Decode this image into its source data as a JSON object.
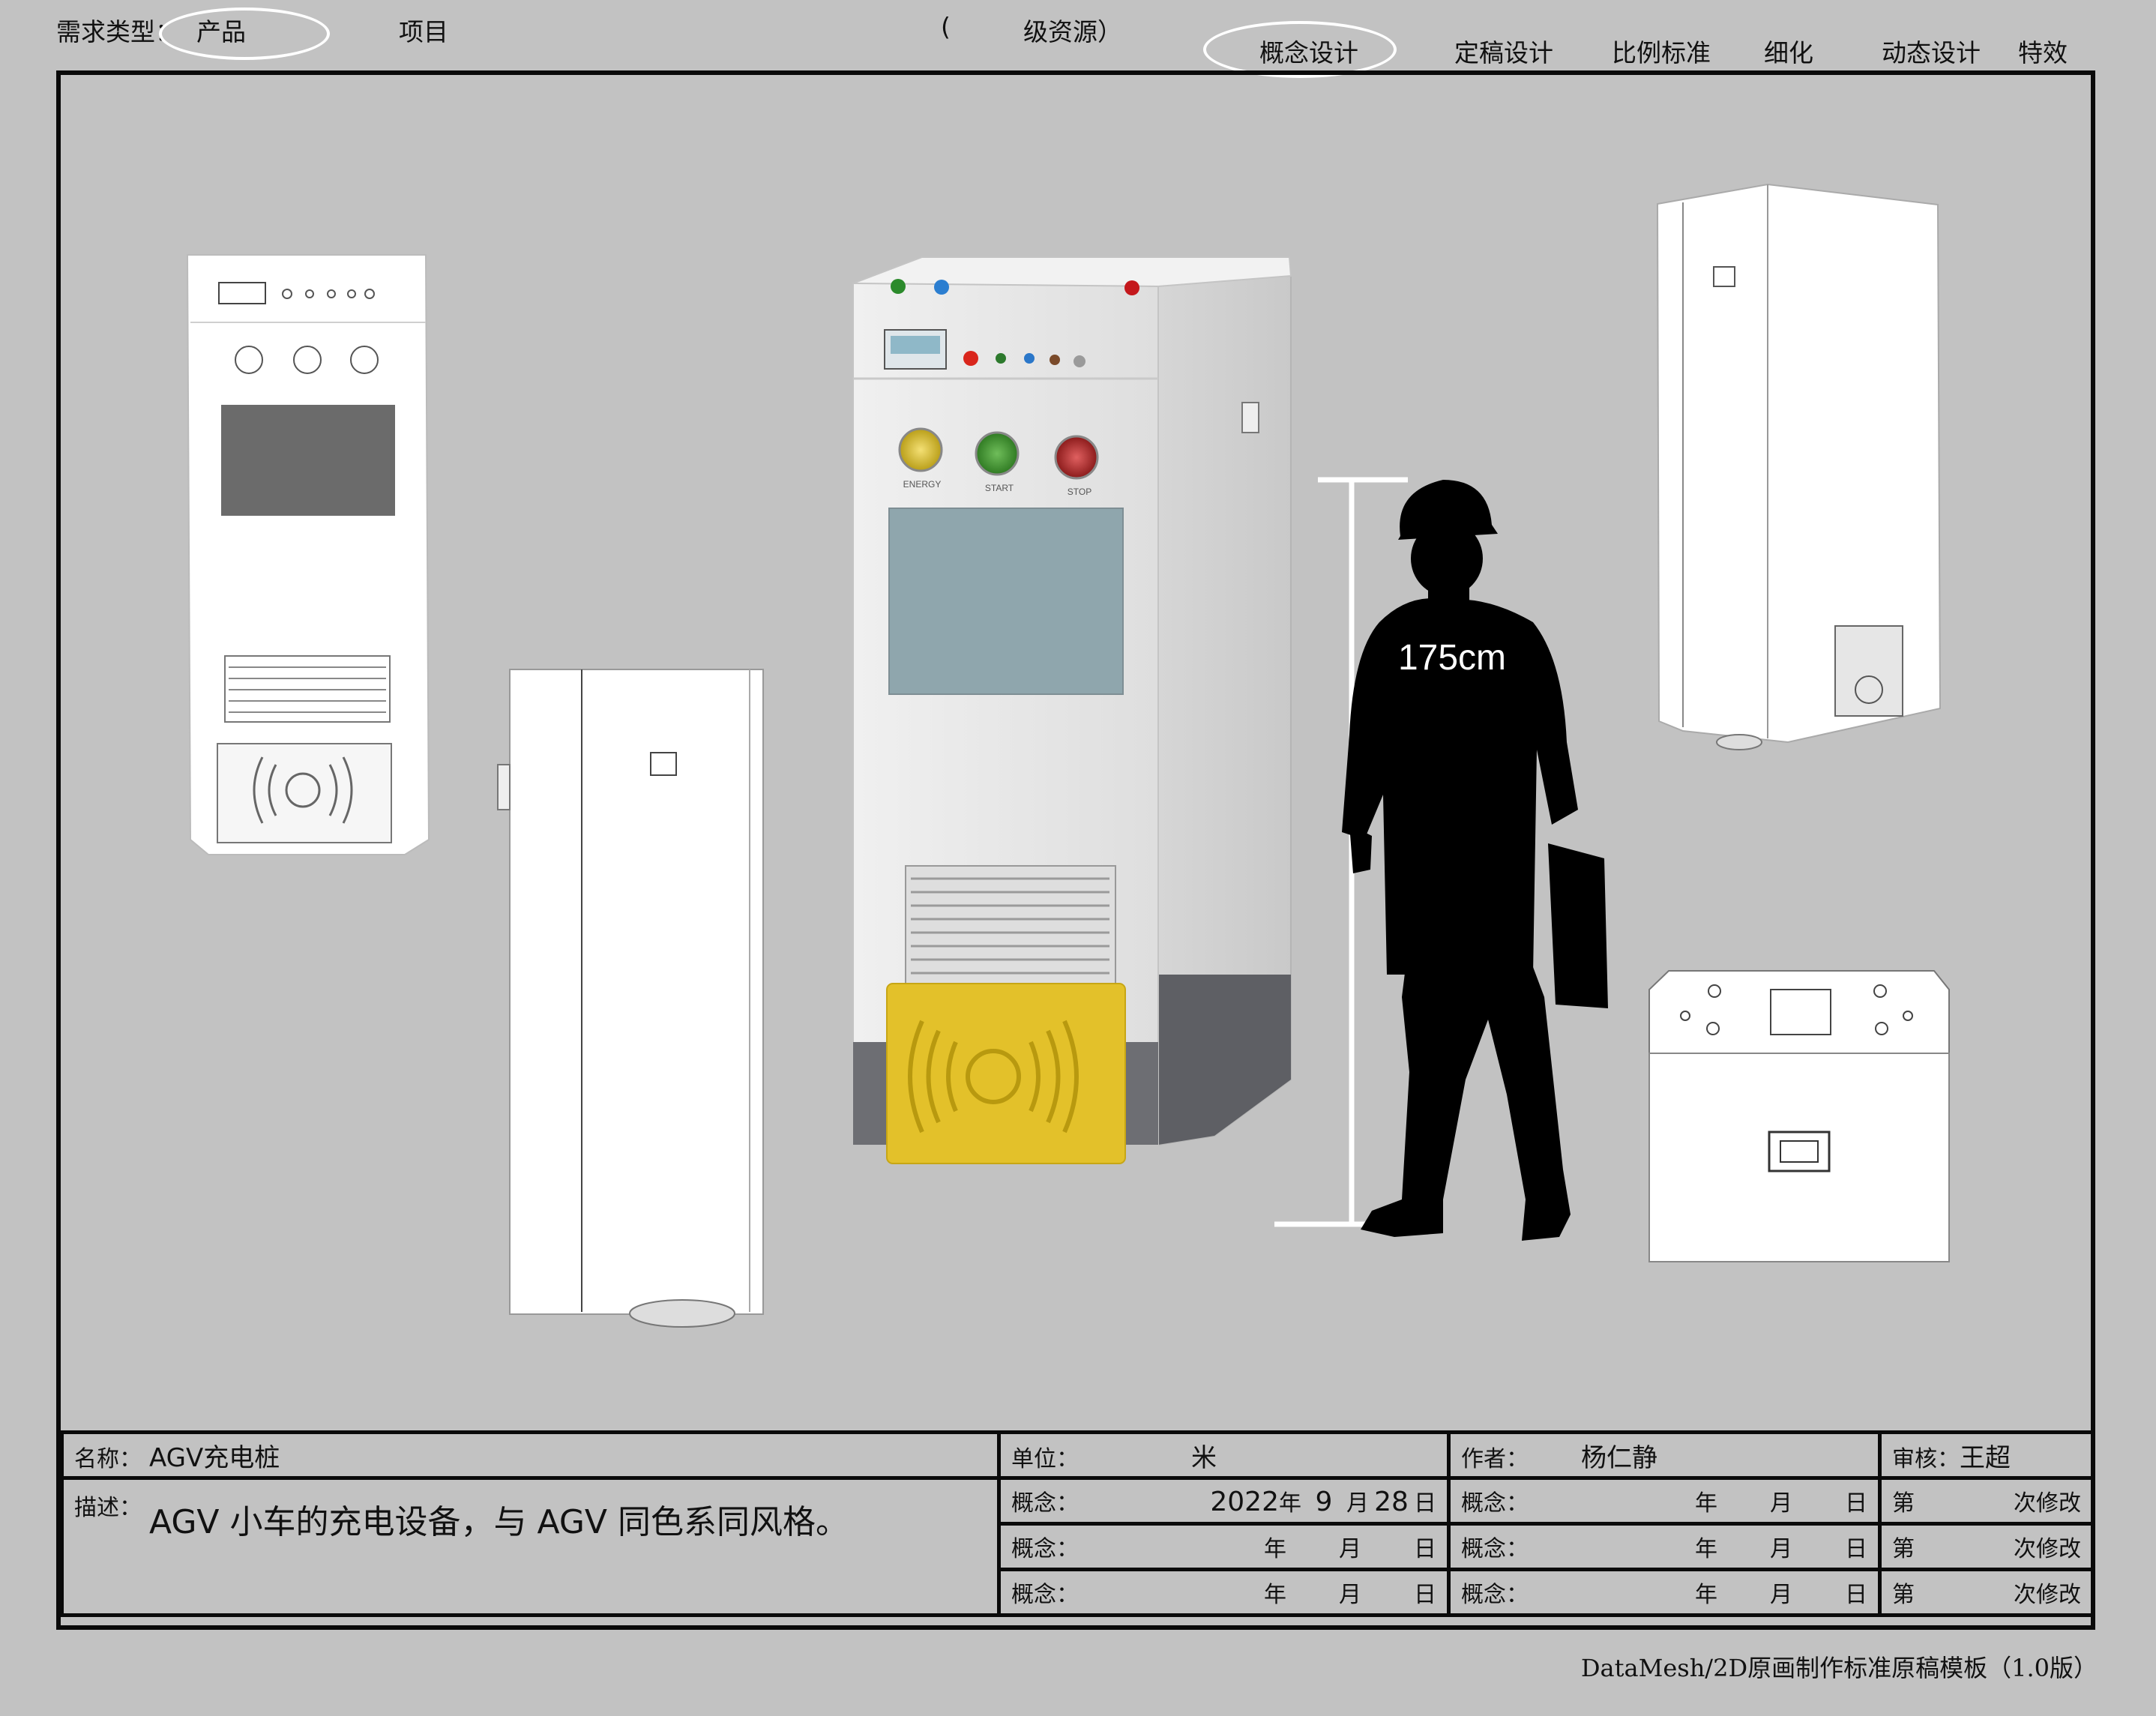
{
  "header": {
    "req_type_label": "需求类型：",
    "req_type_product": "产品",
    "req_type_project": "项目",
    "resource_open": "(",
    "resource_label": "级资源）",
    "stages": [
      "概念设计",
      "定稿设计",
      "比例标准",
      "细化",
      "动态设计",
      "特效"
    ],
    "selected_stage": "概念设计"
  },
  "illustration": {
    "button_labels": [
      "ENERGY",
      "START",
      "STOP"
    ],
    "height_marker": "175cm",
    "colors": {
      "yellow_panel": "#e3c12a",
      "screen": "#8fa6ad",
      "body": "#e6e6e6",
      "base": "#6d6e73",
      "silhouette": "#000000"
    }
  },
  "table": {
    "name_label": "名称：",
    "name_value": "AGV充电桩",
    "desc_label": "描述：",
    "desc_value": "AGV 小车的充电设备，与 AGV 同色系同风格。",
    "unit_label": "单位：",
    "unit_value": "米",
    "author_label": "作者：",
    "author_value": "杨仁静",
    "review_label": "审核：",
    "review_value": "王超",
    "concept_label": "概念：",
    "year_char": "年",
    "month_char": "月",
    "day_char": "日",
    "date1": {
      "year": "2022",
      "month": "9",
      "day": "28"
    },
    "revision_prefix": "第",
    "revision_suffix": "次修改"
  },
  "footer": "DataMesh/2D原画制作标准原稿模板（1.0版）"
}
